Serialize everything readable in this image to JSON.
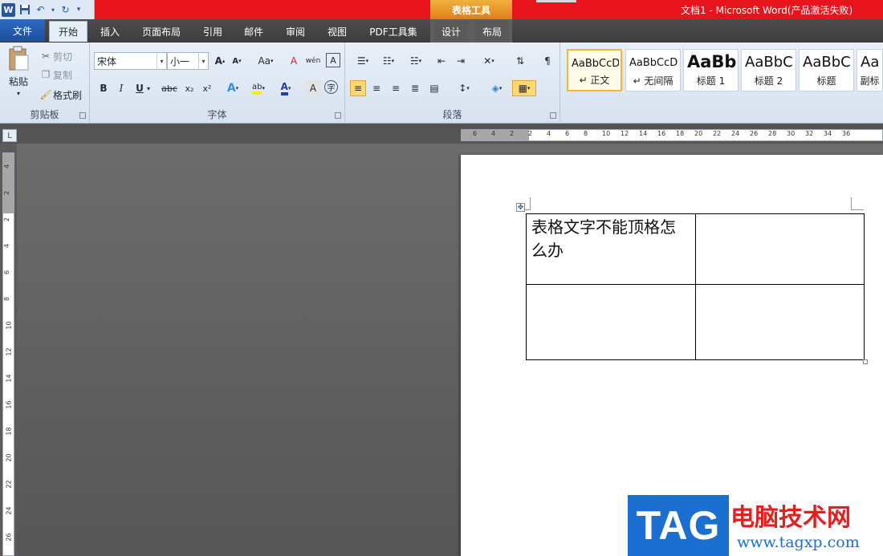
{
  "titlebar": {
    "title": "文档1 - Microsoft Word(产品激活失败)",
    "context_tab_group": "表格工具",
    "quick_access": [
      "word-logo",
      "save-icon",
      "undo-icon",
      "redo-icon",
      "customize-icon"
    ]
  },
  "tabs": [
    {
      "label": "文件",
      "kind": "file"
    },
    {
      "label": "开始",
      "kind": "active"
    },
    {
      "label": "插入",
      "kind": "normal"
    },
    {
      "label": "页面布局",
      "kind": "normal"
    },
    {
      "label": "引用",
      "kind": "normal"
    },
    {
      "label": "邮件",
      "kind": "normal"
    },
    {
      "label": "审阅",
      "kind": "normal"
    },
    {
      "label": "视图",
      "kind": "normal"
    },
    {
      "label": "PDF工具集",
      "kind": "normal"
    },
    {
      "label": "设计",
      "kind": "context"
    },
    {
      "label": "布局",
      "kind": "context"
    }
  ],
  "ribbon": {
    "clipboard": {
      "label": "剪贴板",
      "paste": "粘贴",
      "cut": "剪切",
      "copy": "复制",
      "format_painter": "格式刷"
    },
    "font": {
      "label": "字体",
      "font_name": "宋体",
      "font_size": "小一",
      "bold": "B",
      "italic": "I",
      "underline": "U",
      "strikethrough": "abc",
      "subscript": "x₂",
      "superscript": "x²",
      "grow": "A",
      "shrink": "A",
      "change_case": "Aa",
      "clear_format": "A",
      "phonetic": "wén",
      "text_effect": "A",
      "highlight": "ab",
      "font_color": "A",
      "char_shading": "A",
      "enclose": "字"
    },
    "paragraph": {
      "label": "段落"
    },
    "styles": [
      {
        "sample": "AaBbCcD",
        "name": "↵ 正文",
        "selected": true,
        "bold": false
      },
      {
        "sample": "AaBbCcD",
        "name": "↵ 无间隔",
        "selected": false,
        "bold": false
      },
      {
        "sample": "AaBb",
        "name": "标题 1",
        "selected": false,
        "bold": true
      },
      {
        "sample": "AaBbC",
        "name": "标题 2",
        "selected": false,
        "bold": false
      },
      {
        "sample": "AaBbC",
        "name": "标题",
        "selected": false,
        "bold": false
      },
      {
        "sample": "AaBl",
        "name": "副标",
        "selected": false,
        "bold": false
      }
    ]
  },
  "ruler": {
    "corner": "L",
    "h_numbers": [
      "6",
      "4",
      "2",
      "2",
      "4",
      "6",
      "8",
      "10",
      "12",
      "14",
      "16",
      "18",
      "20",
      "22",
      "24",
      "26",
      "28",
      "30",
      "32",
      "34",
      "36"
    ],
    "v_numbers": [
      "4",
      "2",
      "2",
      "4",
      "6",
      "8",
      "10",
      "12",
      "14",
      "16",
      "18",
      "20",
      "22",
      "24",
      "26"
    ]
  },
  "document": {
    "table": [
      [
        "表格文字不能顶格怎么办",
        ""
      ],
      [
        "",
        ""
      ]
    ]
  },
  "watermark": {
    "tag": "TAG",
    "name": "电脑技术网",
    "url": "www.tagxp.com"
  }
}
